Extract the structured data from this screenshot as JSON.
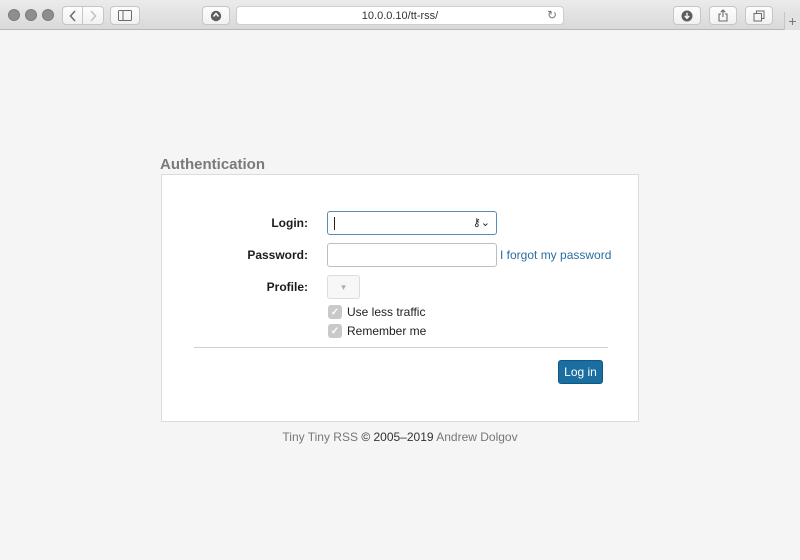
{
  "browser": {
    "url": "10.0.0.10/tt-rss/",
    "icons": {
      "back": "chevron-left-icon",
      "forward": "chevron-right-icon",
      "sidebar": "sidebar-icon",
      "shield": "shield-icon",
      "reload": "reload-icon",
      "download": "download-icon",
      "share": "share-icon",
      "tabs": "tabs-icon",
      "new_tab": "plus-icon"
    }
  },
  "auth": {
    "title": "Authentication",
    "login_label": "Login:",
    "login_value": "",
    "password_label": "Password:",
    "password_value": "",
    "forgot_link": "I forgot my password",
    "profile_label": "Profile:",
    "profile_selected": "",
    "checkboxes": [
      {
        "label": "Use less traffic",
        "checked": true
      },
      {
        "label": "Remember me",
        "checked": true
      }
    ],
    "login_button": "Log in"
  },
  "footer": {
    "app_name": "Tiny Tiny RSS",
    "copyright": "© 2005–2019",
    "author": "Andrew Dolgov"
  },
  "colors": {
    "page_background": "#f5f5f5",
    "title_gray": "#7a7a7a",
    "link_blue": "#2a6ea1",
    "button_blue": "#1a6fa0"
  }
}
